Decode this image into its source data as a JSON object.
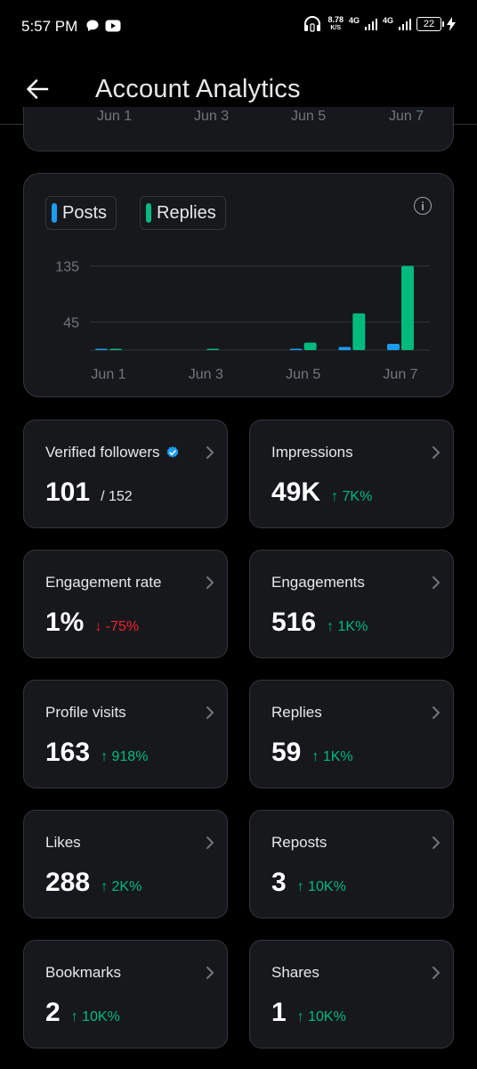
{
  "status_bar": {
    "time": "5:57 PM",
    "speed_value": "8.78",
    "speed_unit": "K/S",
    "net1": "4G",
    "net2": "4G",
    "battery": "22"
  },
  "header": {
    "title": "Account Analytics"
  },
  "prev_chart": {
    "x_labels": [
      "Jun 1",
      "Jun 3",
      "Jun 5",
      "Jun 7"
    ]
  },
  "legend": {
    "posts": "Posts",
    "replies": "Replies"
  },
  "colors": {
    "posts": "#1d9bf0",
    "replies": "#00ba7c",
    "up": "#00ba7c",
    "down": "#f4212e"
  },
  "chart_data": {
    "type": "bar",
    "categories": [
      "Jun 1",
      "Jun 2",
      "Jun 3",
      "Jun 4",
      "Jun 5",
      "Jun 6",
      "Jun 7"
    ],
    "x_tick_labels": [
      "Jun 1",
      "Jun 3",
      "Jun 5",
      "Jun 7"
    ],
    "y_ticks": [
      45,
      135
    ],
    "ylim": [
      0,
      140
    ],
    "series": [
      {
        "name": "Posts",
        "values": [
          1,
          0,
          0,
          0,
          1,
          5,
          10
        ]
      },
      {
        "name": "Replies",
        "values": [
          2,
          0,
          2,
          0,
          12,
          59,
          135
        ]
      }
    ],
    "grid": true,
    "legend_position": "top-left"
  },
  "stats": [
    {
      "label": "Verified followers",
      "value": "101",
      "sub": "/ 152",
      "change": "",
      "dir": ""
    },
    {
      "label": "Impressions",
      "value": "49K",
      "sub": "",
      "change": "↑ 7K%",
      "dir": "up"
    },
    {
      "label": "Engagement rate",
      "value": "1%",
      "sub": "",
      "change": "↓ -75%",
      "dir": "down"
    },
    {
      "label": "Engagements",
      "value": "516",
      "sub": "",
      "change": "↑ 1K%",
      "dir": "up"
    },
    {
      "label": "Profile visits",
      "value": "163",
      "sub": "",
      "change": "↑ 918%",
      "dir": "up"
    },
    {
      "label": "Replies",
      "value": "59",
      "sub": "",
      "change": "↑ 1K%",
      "dir": "up"
    },
    {
      "label": "Likes",
      "value": "288",
      "sub": "",
      "change": "↑ 2K%",
      "dir": "up"
    },
    {
      "label": "Reposts",
      "value": "3",
      "sub": "",
      "change": "↑ 10K%",
      "dir": "up"
    },
    {
      "label": "Bookmarks",
      "value": "2",
      "sub": "",
      "change": "↑ 10K%",
      "dir": "up"
    },
    {
      "label": "Shares",
      "value": "1",
      "sub": "",
      "change": "↑ 10K%",
      "dir": "up"
    }
  ]
}
